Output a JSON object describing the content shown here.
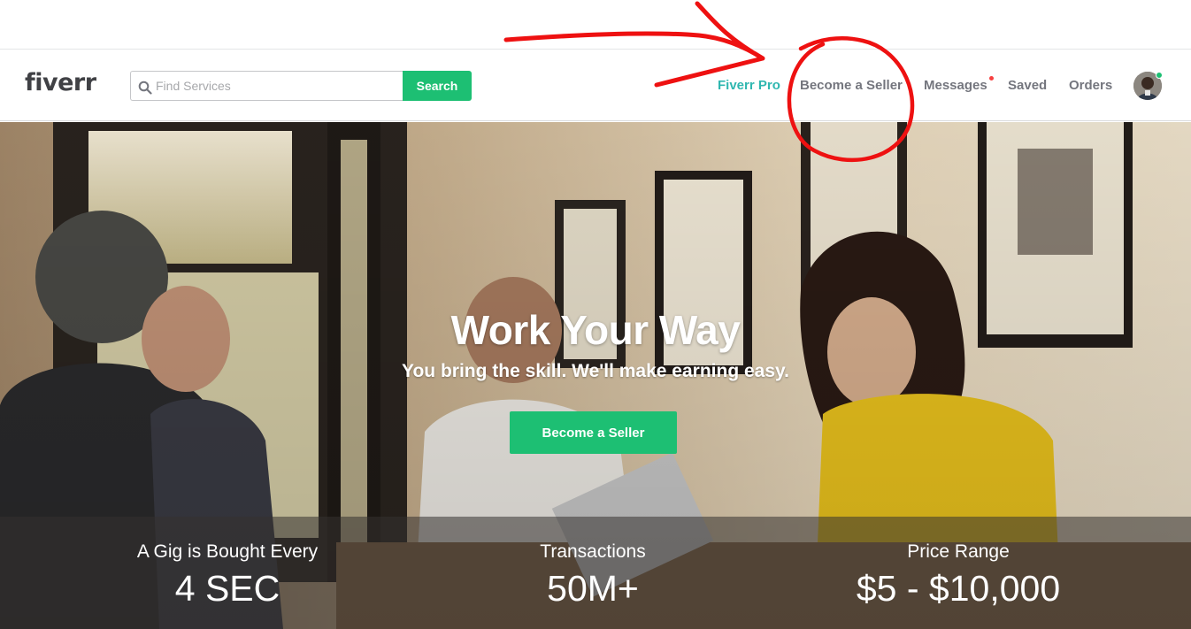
{
  "header": {
    "logo": "fiverr",
    "search": {
      "placeholder": "Find Services",
      "value": "",
      "button_label": "Search"
    },
    "nav": {
      "fiverr_pro": "Fiverr Pro",
      "become_seller": "Become a Seller",
      "messages": "Messages",
      "saved": "Saved",
      "orders": "Orders"
    },
    "messages_has_notification": true,
    "user_online": true
  },
  "hero": {
    "title": "Work Your Way",
    "subtitle": "You bring the skill. We'll make earning easy.",
    "cta_label": "Become a Seller"
  },
  "stats": [
    {
      "label": "A Gig is Bought Every",
      "value": "4 SEC"
    },
    {
      "label": "Transactions",
      "value": "50M+"
    },
    {
      "label": "Price Range",
      "value": "$5 - $10,000"
    }
  ],
  "colors": {
    "brand_green": "#1dbf73",
    "pro_teal": "#2fb7b0",
    "nav_text": "#74767e",
    "annotation_red": "#ee1111"
  },
  "annotations": {
    "arrow": "red-hand-drawn-arrow",
    "circle": "red-hand-drawn-circle-around-become-a-seller"
  }
}
